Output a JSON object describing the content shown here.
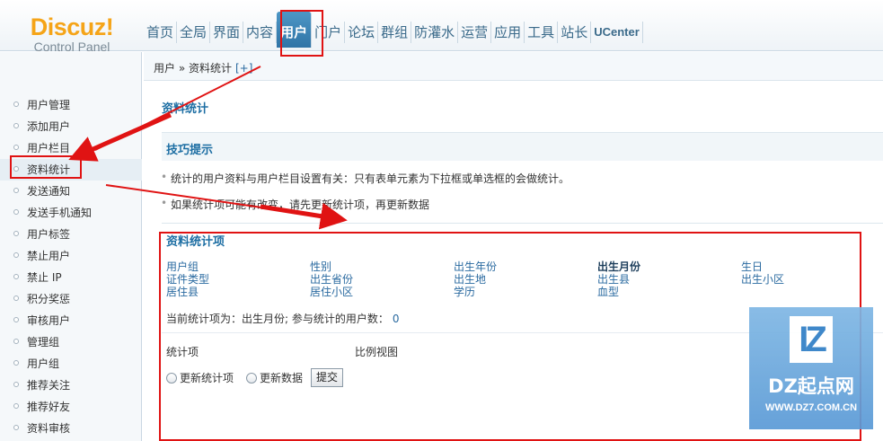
{
  "logo": {
    "brand": "Discuz!",
    "sub": "Control Panel"
  },
  "nav": [
    "首页",
    "全局",
    "界面",
    "内容",
    "用户",
    "门户",
    "论坛",
    "群组",
    "防灌水",
    "运营",
    "应用",
    "工具",
    "站长",
    "UCenter"
  ],
  "nav_active": "用户",
  "breadcrumb": {
    "text": "用户 » 资料统计",
    "add": "[+]"
  },
  "sidebar": {
    "items": [
      "用户管理",
      "添加用户",
      "用户栏目",
      "资料统计",
      "发送通知",
      "发送手机通知",
      "用户标签",
      "禁止用户",
      "禁止 IP",
      "积分奖惩",
      "审核用户",
      "管理组",
      "用户组",
      "推荐关注",
      "推荐好友",
      "资料审核"
    ],
    "active": "资料统计"
  },
  "main": {
    "title": "资料统计",
    "tips_title": "技巧提示",
    "tips": [
      "统计的用户资料与用户栏目设置有关：只有表单元素为下拉框或单选框的会做统计。",
      "如果统计项可能有改变，请先更新统计项，再更新数据"
    ],
    "stats_title": "资料统计项",
    "options": [
      [
        "用户组",
        "证件类型",
        "居住县"
      ],
      [
        "性别",
        "出生省份",
        "居住小区"
      ],
      [
        "出生年份",
        "出生地",
        "学历"
      ],
      [
        "出生月份",
        "出生县",
        "血型"
      ],
      [
        "生日",
        "出生小区"
      ]
    ],
    "current_label": "当前统计项为：出生月份; 参与统计的用户数：",
    "current_count": "0",
    "th_item": "统计项",
    "th_ratio": "比例视图",
    "radio_update_items": "更新统计项",
    "radio_update_data": "更新数据",
    "submit": "提交"
  },
  "watermark": {
    "logo": "IZ",
    "name": "DZ起点网",
    "url": "WWW.DZ7.COM.CN"
  },
  "colors": {
    "accent": "#1d6ea3",
    "nav_active": "#2f74a6",
    "highlight": "#e01313",
    "logo": "#f5a418"
  }
}
